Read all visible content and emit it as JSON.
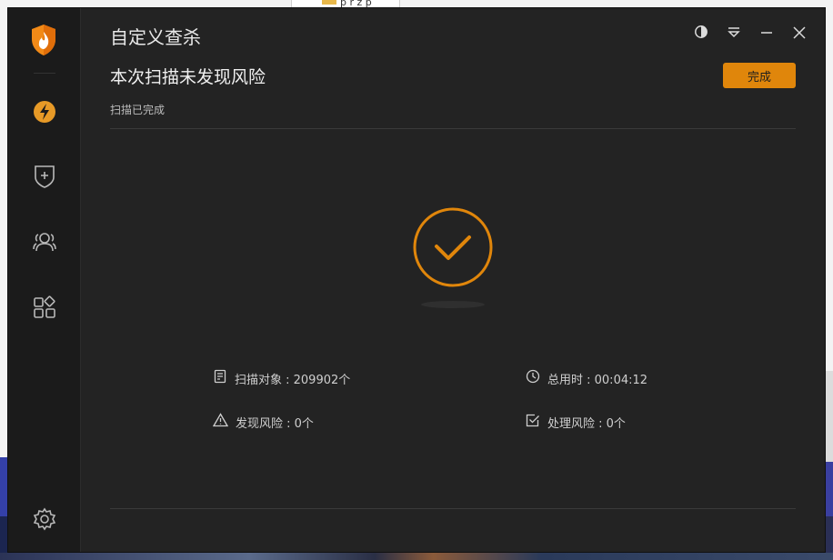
{
  "desktop": {
    "folder_label": "p r z p"
  },
  "window": {
    "title": "自定义查杀",
    "controls": [
      "contrast-icon",
      "menu-dropdown-icon",
      "minimize-icon",
      "close-icon"
    ]
  },
  "sidebar": {
    "items": [
      {
        "icon": "lightning-icon",
        "accent": "#e79a27"
      },
      {
        "icon": "shield-plus-icon"
      },
      {
        "icon": "users-icon"
      },
      {
        "icon": "apps-grid-icon"
      }
    ],
    "settings_icon": "gear-icon"
  },
  "scan_result": {
    "heading": "本次扫描未发现风险",
    "status": "扫描已完成",
    "done_button": "完成",
    "result_icon": "check-circle-icon",
    "accent_color": "#e0860b"
  },
  "stats": {
    "scanned_objects": "扫描对象 : 209902个",
    "total_time": "总用时 : 00:04:12",
    "risks_found": "发现风险 : 0个",
    "risks_handled": "处理风险 : 0个"
  }
}
